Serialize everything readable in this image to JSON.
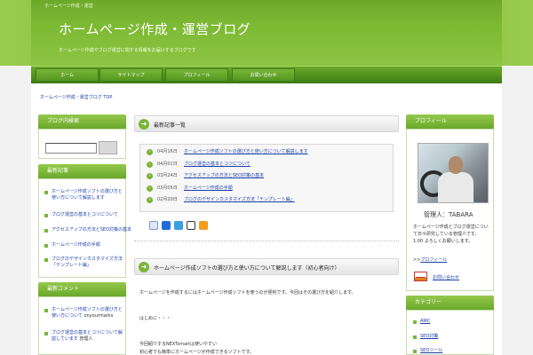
{
  "header": {
    "tagline": "ホームページ作成・運営",
    "title": "ホームページ作成・運営ブログ",
    "description": "ホームページ作成やブログ運営に関する情報をお届けするブログです"
  },
  "nav": [
    "ホーム",
    "サイトマップ",
    "プロフィール",
    "お問い合わせ"
  ],
  "breadcrumb": "ホームページ作成・運営ブログ TOP",
  "left": {
    "search_title": "ブログ内検索",
    "search_button": "",
    "recent_title": "最新記事",
    "recent_items": [
      "ホームページ作成ソフトの選び方と使い方について解説します",
      "ブログ運営の基本とコツについて",
      "アクセスアップの方法とSEO対策の基本",
      "ホームページ作成の手順",
      "ブログのデザインカスタマイズ方法「テンプレート編」"
    ],
    "comments_title": "最新コメント",
    "comments": [
      {
        "text": "ホームページ作成ソフトの選び方と使い方について",
        "by": "onyourmarks"
      },
      {
        "text": "ブログ運営の基本とコツについて解説しています",
        "by": "管理人"
      }
    ]
  },
  "main": {
    "recent_heading": "最新記事一覧",
    "recent": [
      {
        "date": "04月16日",
        "title": "ホームページ作成ソフトの選び方と使い方について解説します"
      },
      {
        "date": "04月01日",
        "title": "ブログ運営の基本とコツについて"
      },
      {
        "date": "03月24日",
        "title": "アクセスアップの方法とSEO対策の基本"
      },
      {
        "date": "03月05日",
        "title": "ホームページ作成の手順"
      },
      {
        "date": "02月20日",
        "title": "ブログのデザインカスタマイズ方法「テンプレート編」"
      }
    ],
    "article_heading": "ホームページ作成ソフトの選び方と使い方について解説します（初心者向け）",
    "body": [
      "ホームページを作成するにはホームページ作成ソフトを使うのが便利です。今回はその選び方を紹介します。",
      "はじめに・・・",
      "今回紹介するNEXTsmartは使いやすい",
      "初心者でも簡単にホームページが作成できるソフトです。"
    ]
  },
  "right": {
    "profile_title": "プロフィール",
    "admin": "管理人：TABARA",
    "bio": [
      "ホームページ作成とブログ運営について日々研究している管理人です。",
      "1.00",
      "よろしくお願いします。"
    ],
    "more_link": "プロフィール",
    "more_prefix": ">>",
    "mail_link": "お問い合わせ",
    "category_title": "カテゴリー",
    "categories": [
      "AMC",
      "SEO対策",
      "SEOツール"
    ]
  },
  "colors": {
    "accent_green": "#7ab53a",
    "header_green": "#71ae2d",
    "link_blue": "#1a3fa8"
  }
}
